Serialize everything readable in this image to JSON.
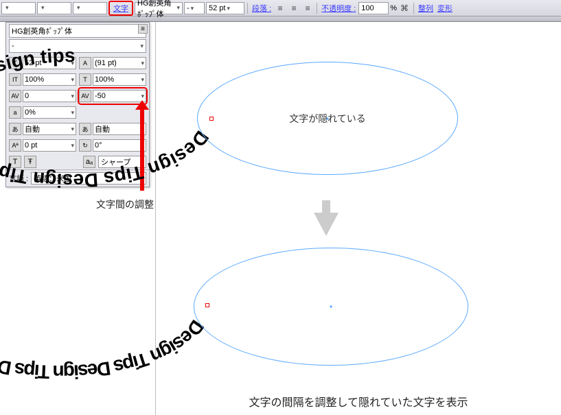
{
  "toolbar": {
    "moji_menu": "文字",
    "font_name": "HG創英角ﾎﾟｯﾌﾟ体",
    "font_style": "-",
    "font_size": "52 pt",
    "paragraph_label": "段落 :",
    "opacity_label": "不透明度 :",
    "opacity_value": "100",
    "opacity_unit": "%",
    "align_label": "整列",
    "transform_label": "変形"
  },
  "panel": {
    "font_name": "HG創英角ﾎﾟｯﾌﾟ体",
    "font_style": "-",
    "size": "52 pt",
    "leading": "(91 pt)",
    "hscale": "100%",
    "vscale": "100%",
    "va": "0",
    "tracking": "-50",
    "baseline_shift": "0%",
    "auto1": "自動",
    "auto2": "自動",
    "pt0": "0 pt",
    "rotate": "0°",
    "sharp": "シャープ",
    "lang_label": "言語 :",
    "lang_value": "英語：米国"
  },
  "canvas": {
    "figure1_caption": "文字が隠れている",
    "path_text": "Design Tips Design Tips Design Tips Design tips",
    "figure2_caption": "文字の間隔を調整して隠れていた文字を表示"
  },
  "annotation": {
    "tracking_label": "文字間の調整"
  },
  "icons": {
    "align_left": "≡",
    "align_center": "≡",
    "align_right": "≡",
    "chain": "⌘",
    "t_icon": "T",
    "f_icon": "Ŧ",
    "aa": "aₐ"
  }
}
